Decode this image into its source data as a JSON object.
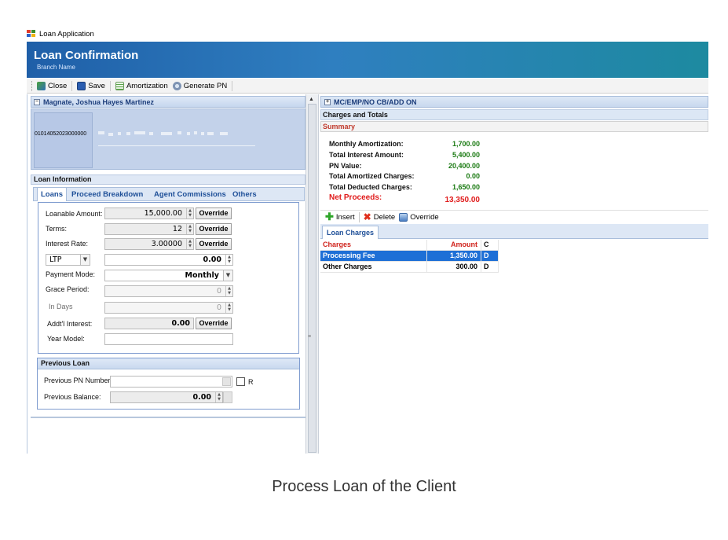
{
  "window": {
    "title": "Loan Application"
  },
  "banner": {
    "title": "Loan Confirmation",
    "subtitle": "Branch Name"
  },
  "toolbar": {
    "close": "Close",
    "save": "Save",
    "amortization": "Amortization",
    "generate_pn": "Generate PN"
  },
  "client": {
    "name": "Magnate, Joshua Hayes  Martinez",
    "id": "01014052023000000"
  },
  "loan_info": {
    "title": "Loan Information",
    "tabs": [
      "Loans",
      "Proceed Breakdown",
      "Agent Commissions",
      "Others"
    ],
    "loanable_amount_label": "Loanable Amount:",
    "loanable_amount": "15,000.00",
    "terms_label": "Terms:",
    "terms": "12",
    "interest_rate_label": "Interest Rate:",
    "interest_rate": "3.00000",
    "ltp_option": "LTP",
    "ltp_value": "0.00",
    "payment_mode_label": "Payment Mode:",
    "payment_mode": "Monthly",
    "grace_period_label": "Grace Period:",
    "grace_period": "0",
    "in_days_label": "In Days",
    "in_days": "0",
    "addtl_interest_label": "Addt'l Interest:",
    "addtl_interest": "0.00",
    "year_model_label": "Year Model:",
    "year_model": "",
    "override": "Override"
  },
  "previous_loan": {
    "title": "Previous Loan",
    "pn_label": "Previous PN Number:",
    "pn_value": "",
    "r_label": "R",
    "balance_label": "Previous Balance:",
    "balance": "0.00"
  },
  "right": {
    "header": "MC/EMP/NO CB/ADD ON",
    "charges_title": "Charges and Totals",
    "summary_title": "Summary",
    "summary": {
      "monthly_amortization_label": "Monthly Amortization:",
      "monthly_amortization": "1,700.00",
      "total_interest_label": "Total Interest Amount:",
      "total_interest": "5,400.00",
      "pn_value_label": "PN Value:",
      "pn_value": "20,400.00",
      "total_amortized_label": "Total Amortized Charges:",
      "total_amortized": "0.00",
      "total_deducted_label": "Total Deducted Charges:",
      "total_deducted": "1,650.00",
      "net_proceeds_label": "Net Proceeds:",
      "net_proceeds": "13,350.00"
    },
    "actions": {
      "insert": "Insert",
      "delete": "Delete",
      "override": "Override"
    },
    "charges_tab": "Loan Charges",
    "grid": {
      "headers": [
        "Charges",
        "Amount",
        "C"
      ],
      "rows": [
        [
          "Processing Fee",
          "1,350.00",
          "D"
        ],
        [
          "Other Charges",
          "300.00",
          "D"
        ]
      ]
    }
  },
  "caption": "Process Loan of the Client",
  "colors": {
    "banner_start": "#1f5fa8",
    "banner_end": "#1d8aa0",
    "positive_value": "#1a7a12",
    "net_proceeds": "#e01b1b",
    "selected_row": "#1e6fd6"
  }
}
